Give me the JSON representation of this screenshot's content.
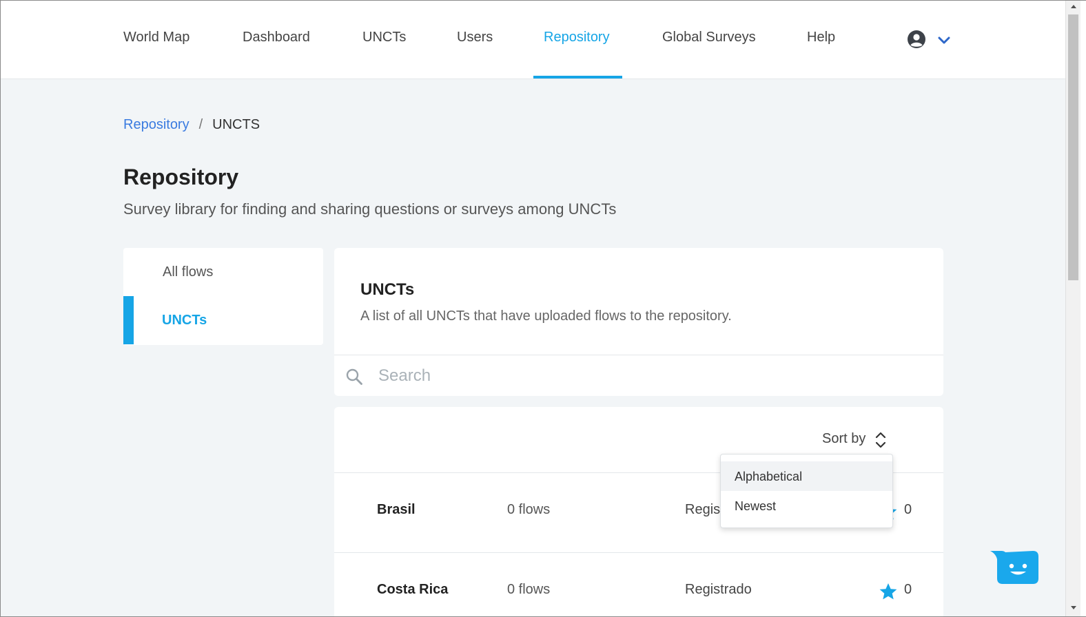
{
  "nav": {
    "items": [
      "World Map",
      "Dashboard",
      "UNCTs",
      "Users",
      "Repository",
      "Global Surveys",
      "Help"
    ],
    "active": "Repository",
    "accent": "#16a5e6",
    "user_icon": "user-circle-icon",
    "menu_icon": "chevron-down-icon"
  },
  "breadcrumb": {
    "link": "Repository",
    "separator": "/",
    "current": "UNCTS"
  },
  "header": {
    "title": "Repository",
    "subtitle": "Survey library for finding and sharing questions or surveys among UNCTs"
  },
  "sidebar": {
    "items": [
      {
        "label": "All flows",
        "active": false
      },
      {
        "label": "UNCTs",
        "active": true
      }
    ]
  },
  "main": {
    "title": "UNCTs",
    "description": "A list of all UNCTs that have uploaded flows to the repository.",
    "search": {
      "placeholder": "Search",
      "value": ""
    }
  },
  "list": {
    "sort_label": "Sort by",
    "rows": [
      {
        "name": "Brasil",
        "flows": "0 flows",
        "status": "Registrado",
        "stars": "0"
      },
      {
        "name": "Costa Rica",
        "flows": "0 flows",
        "status": "Registrado",
        "stars": "0"
      }
    ]
  },
  "sort_dropdown": {
    "options": [
      "Alphabetical",
      "Newest"
    ],
    "highlighted": "Alphabetical"
  },
  "chat": {
    "icon": "chat-bot-icon",
    "color": "#1aa8ec"
  }
}
